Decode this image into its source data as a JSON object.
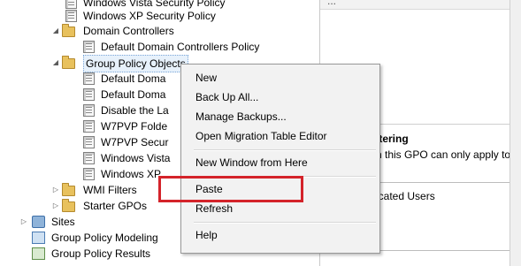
{
  "tree": {
    "items": [
      {
        "label": "Windows Vista Security Policy"
      },
      {
        "label": "Windows XP Security Policy"
      },
      {
        "label": "Domain Controllers"
      },
      {
        "label": "Default Domain Controllers Policy"
      },
      {
        "label": "Group Policy Objects"
      },
      {
        "label": "Default Doma"
      },
      {
        "label": "Default Doma"
      },
      {
        "label": "Disable the La"
      },
      {
        "label": "W7PVP Folde"
      },
      {
        "label": "W7PVP Secur"
      },
      {
        "label": "Windows Vista"
      },
      {
        "label": "Windows XP"
      },
      {
        "label": "WMI Filters"
      },
      {
        "label": "Starter GPOs"
      },
      {
        "label": "Sites"
      },
      {
        "label": "Group Policy Modeling"
      },
      {
        "label": "Group Policy Results"
      }
    ]
  },
  "right_pane": {
    "top_fragment": "...",
    "heading": "ltering",
    "description": "n this GPO can only apply to the fo",
    "list_item": "icated Users"
  },
  "context_menu": {
    "items": [
      {
        "label": "New"
      },
      {
        "label": "Back Up All..."
      },
      {
        "label": "Manage Backups..."
      },
      {
        "label": "Open Migration Table Editor"
      },
      {
        "label": "New Window from Here"
      },
      {
        "label": "Paste"
      },
      {
        "label": "Refresh"
      },
      {
        "label": "Help"
      }
    ]
  },
  "colors": {
    "highlight_border": "#d4232a",
    "menu_background": "#f2f2f2",
    "selection": "#e7f1fb"
  }
}
